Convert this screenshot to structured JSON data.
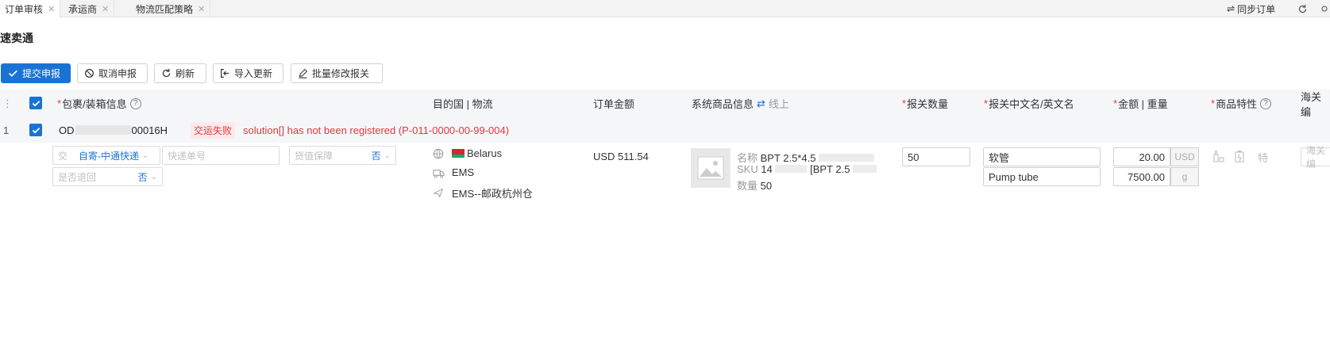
{
  "tabs": [
    {
      "label": "订单审核"
    },
    {
      "label": "承运商"
    },
    {
      "label": "物流匹配策略"
    }
  ],
  "top_right": {
    "sync_label": "同步订单"
  },
  "page_title": "速卖通",
  "toolbar": {
    "submit": "提交申报",
    "cancel": "取消申报",
    "refresh": "刷新",
    "import": "导入更新",
    "batch_edit": "批量修改报关"
  },
  "columns": {
    "package_info": "包裹/装箱信息",
    "destination": "目的国 | 物流",
    "order_amount": "订单金额",
    "product_info": "系统商品信息",
    "online": "线上",
    "declare_qty": "报关数量",
    "declare_name": "报关中文名/英文名",
    "amount_weight": "金额 | 重量",
    "product_attr": "商品特性",
    "customs_code": "海关编"
  },
  "row": {
    "index": "1",
    "order_no": "OD",
    "order_no_tail": "00016H",
    "status_badge": "交运失败",
    "error_message": "solution[] has not been registered (P-011-0000-00-99-004)",
    "ship_mode_label": "交",
    "ship_mode_value": "自寄-中通快递",
    "tracking_placeholder": "快递单号",
    "insurance_label": "贷值保障",
    "insurance_value": "否",
    "return_label": "是否退回",
    "return_value": "否",
    "country": "Belarus",
    "logistics": "EMS",
    "warehouse": "EMS--邮政杭州仓",
    "amount": "USD 511.54",
    "product_name_label": "名称",
    "product_name": "BPT 2.5*4.5",
    "sku_label": "SKU",
    "sku": "14",
    "sku_extra": "[BPT 2.5",
    "qty_label": "数量",
    "qty": "50",
    "declare_qty": "50",
    "name_cn": "软管",
    "name_en": "Pump tube",
    "price": "20.00",
    "currency": "USD",
    "weight": "7500.00",
    "weight_unit": "g",
    "attr_special": "特",
    "customs_placeholder": "海关编"
  },
  "colors": {
    "primary": "#1a73d4",
    "error": "#e0393e"
  }
}
